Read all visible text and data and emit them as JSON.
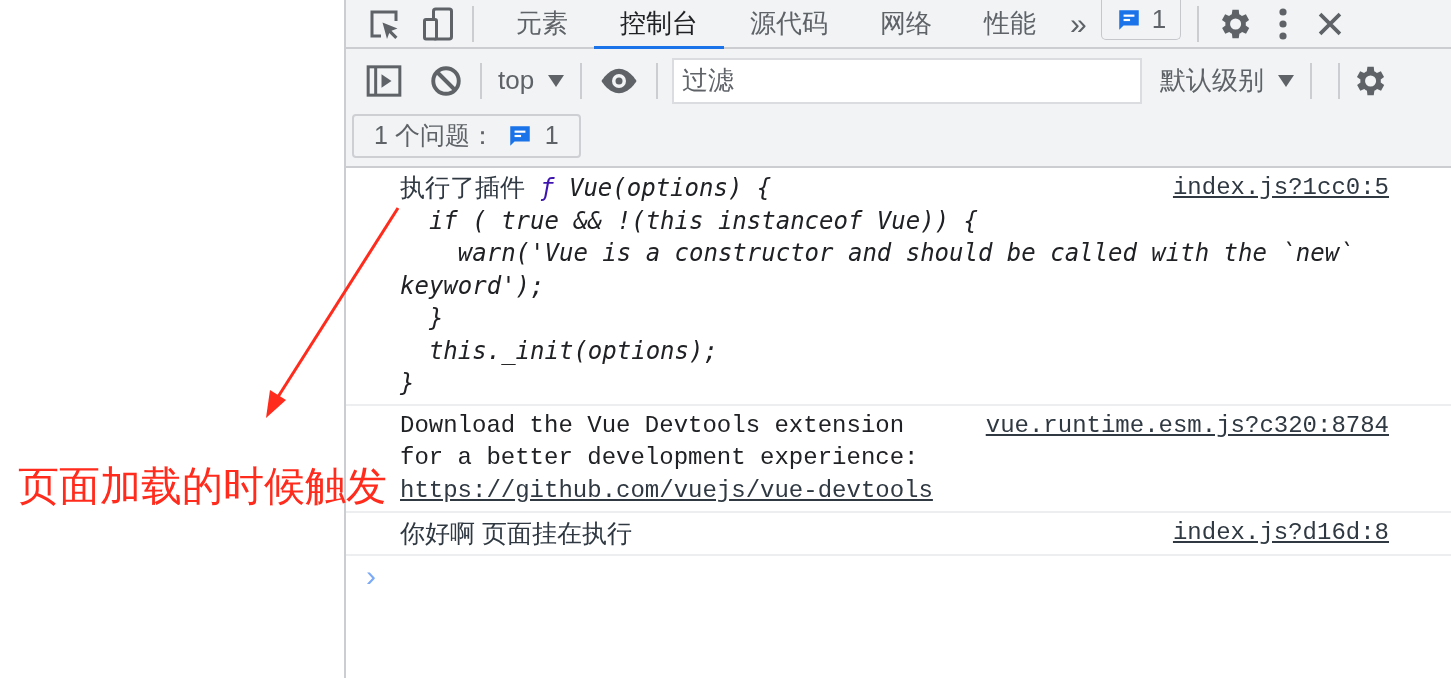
{
  "main_tabs": [
    {
      "label": "元素",
      "selected": false
    },
    {
      "label": "控制台",
      "selected": true
    },
    {
      "label": "源代码",
      "selected": false
    },
    {
      "label": "网络",
      "selected": false
    },
    {
      "label": "性能",
      "selected": false
    }
  ],
  "more_tabs": "»",
  "issues_badge": "1",
  "console_toolbar": {
    "context": "top",
    "filter": {
      "placeholder": "过滤"
    },
    "levels": "默认级别"
  },
  "issues_button": {
    "label": "1 个问题：",
    "count": "1"
  },
  "messages": [
    {
      "kind": "function",
      "prefix": "执行了插件 ",
      "fn_sign": "ƒ",
      "signature": " Vue(options) {",
      "code": "  if ( true && !(this instanceof Vue)) {\n    warn('Vue is a constructor and should be called with the `new` keyword');\n  }\n  this._init(options);\n}",
      "source": "index.js?1cc0:5"
    },
    {
      "kind": "log",
      "text": "Download the Vue Devtools extension for a better development experience:",
      "link": "https://github.com/vuejs/vue-devtools",
      "source": "vue.runtime.esm.js?c320:8784"
    },
    {
      "kind": "plain",
      "text": "你好啊 页面挂在执行",
      "source": "index.js?d16d:8"
    }
  ],
  "prompt": "›",
  "annotation": {
    "text": "页面加载的时候触发"
  }
}
